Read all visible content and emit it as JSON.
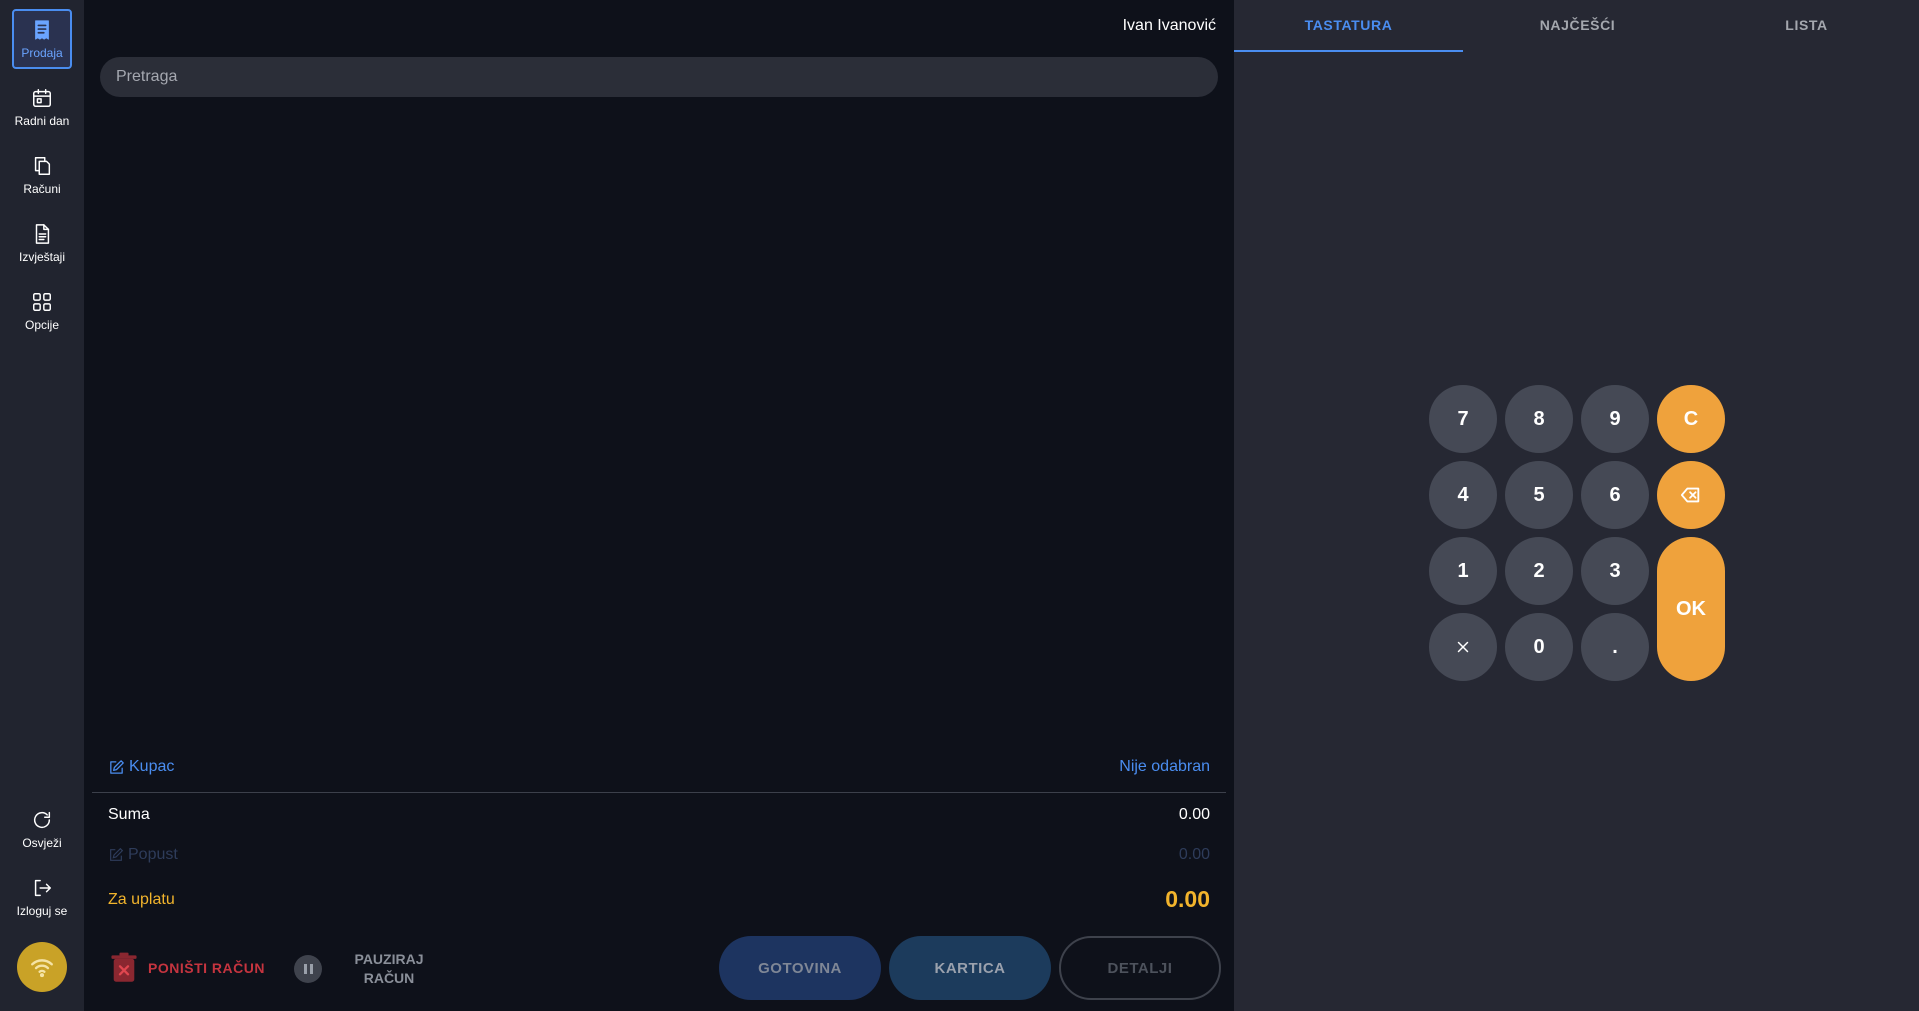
{
  "sidebar": {
    "items": [
      {
        "label": "Prodaja",
        "icon": "receipt-icon",
        "active": true
      },
      {
        "label": "Radni dan",
        "icon": "calendar-icon"
      },
      {
        "label": "Računi",
        "icon": "copy-documents-icon"
      },
      {
        "label": "Izvještaji",
        "icon": "report-document-icon"
      },
      {
        "label": "Opcije",
        "icon": "grid-icon"
      }
    ],
    "bottom_items": [
      {
        "label": "Osvježi",
        "icon": "refresh-icon"
      },
      {
        "label": "Izloguj se",
        "icon": "logout-icon"
      }
    ],
    "status_icon": "wifi-icon"
  },
  "header": {
    "user_name": "Ivan Ivanović"
  },
  "search": {
    "placeholder": "Pretraga"
  },
  "summary": {
    "customer_label": "Kupac",
    "customer_value": "Nije odabran",
    "sum_label": "Suma",
    "sum_value": "0.00",
    "discount_label": "Popust",
    "discount_value": "0.00",
    "to_pay_label": "Za uplatu",
    "to_pay_value": "0.00"
  },
  "actions": {
    "cancel_label": "PONIŠTI RAČUN",
    "pause_label_line1": "PAUZIRAJ",
    "pause_label_line2": "RAČUN",
    "cash_label": "GOTOVINA",
    "card_label": "KARTICA",
    "details_label": "DETALJI"
  },
  "tabs": [
    {
      "label": "TASTATURA",
      "active": true
    },
    {
      "label": "NAJČEŠĆI"
    },
    {
      "label": "LISTA"
    }
  ],
  "keypad": {
    "k7": "7",
    "k8": "8",
    "k9": "9",
    "clear": "C",
    "k4": "4",
    "k5": "5",
    "k6": "6",
    "k1": "1",
    "k2": "2",
    "k3": "3",
    "ok": "OK",
    "k0": "0",
    "dot": "."
  },
  "colors": {
    "accent": "#4a8df0",
    "warning": "#efa23c",
    "total": "#f2b42c",
    "danger": "#c5343f"
  }
}
